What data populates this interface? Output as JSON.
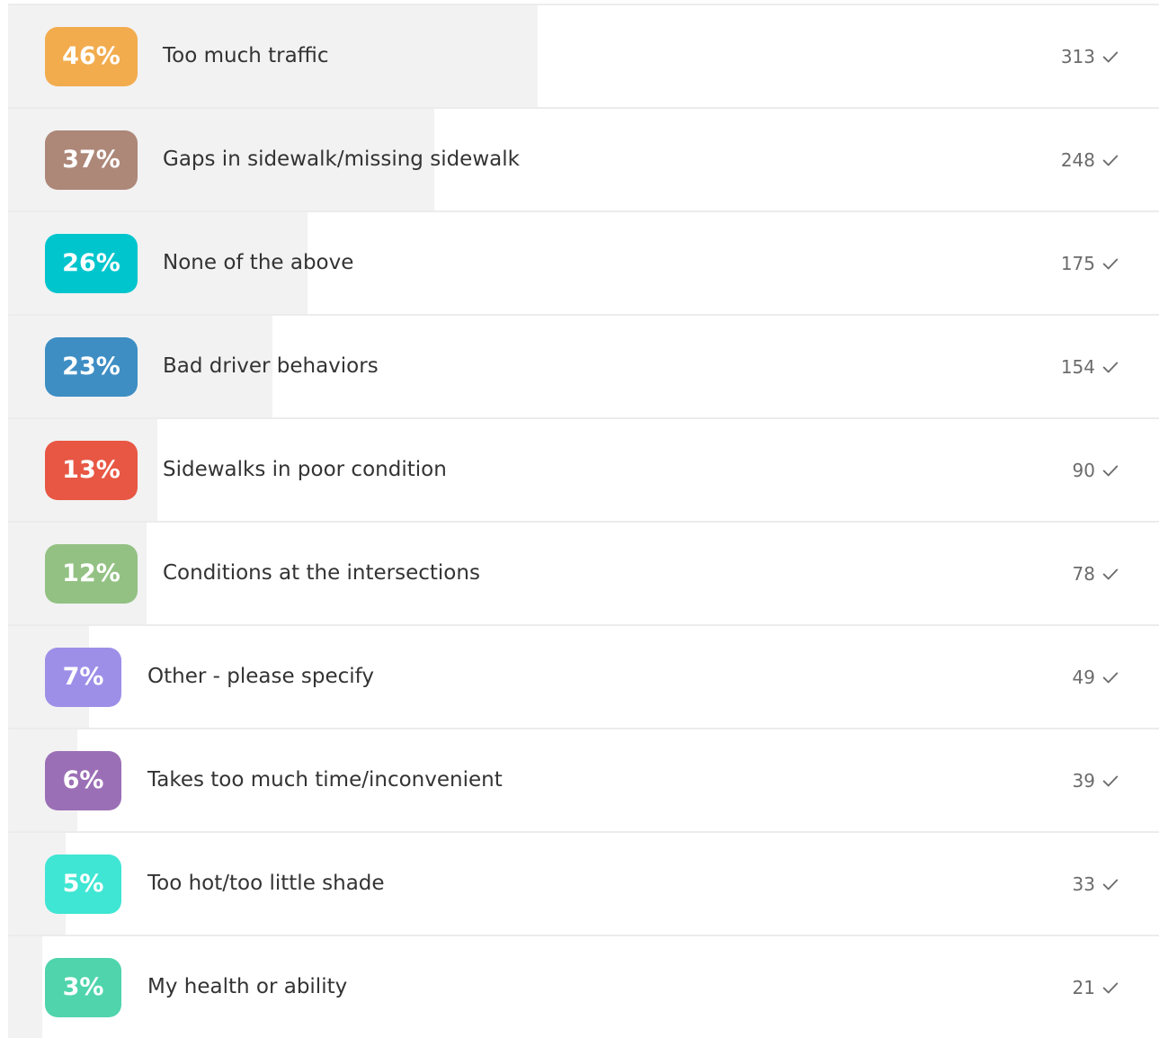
{
  "results": [
    {
      "percent_label": "46%",
      "percent": 46,
      "label": "Too much traffic",
      "count": "313",
      "color": "#f2ac4e"
    },
    {
      "percent_label": "37%",
      "percent": 37,
      "label": "Gaps in sidewalk/missing sidewalk",
      "count": "248",
      "color": "#ad8778"
    },
    {
      "percent_label": "26%",
      "percent": 26,
      "label": "None of the above",
      "count": "175",
      "color": "#00c5cd"
    },
    {
      "percent_label": "23%",
      "percent": 23,
      "label": "Bad driver behaviors",
      "count": "154",
      "color": "#3e8ec4"
    },
    {
      "percent_label": "13%",
      "percent": 13,
      "label": "Sidewalks in poor condition",
      "count": "90",
      "color": "#e85744"
    },
    {
      "percent_label": "12%",
      "percent": 12,
      "label": "Conditions at the intersections",
      "count": "78",
      "color": "#93c183"
    },
    {
      "percent_label": "7%",
      "percent": 7,
      "label": "Other - please specify",
      "count": "49",
      "color": "#9d8fe8"
    },
    {
      "percent_label": "6%",
      "percent": 6,
      "label": "Takes too much time/inconvenient",
      "count": "39",
      "color": "#9b6fb6"
    },
    {
      "percent_label": "5%",
      "percent": 5,
      "label": "Too hot/too little shade",
      "count": "33",
      "color": "#3fe6d3"
    },
    {
      "percent_label": "3%",
      "percent": 3,
      "label": "My health or ability",
      "count": "21",
      "color": "#4fd4ac"
    }
  ],
  "icons": {
    "count_suffix": "check-icon"
  }
}
